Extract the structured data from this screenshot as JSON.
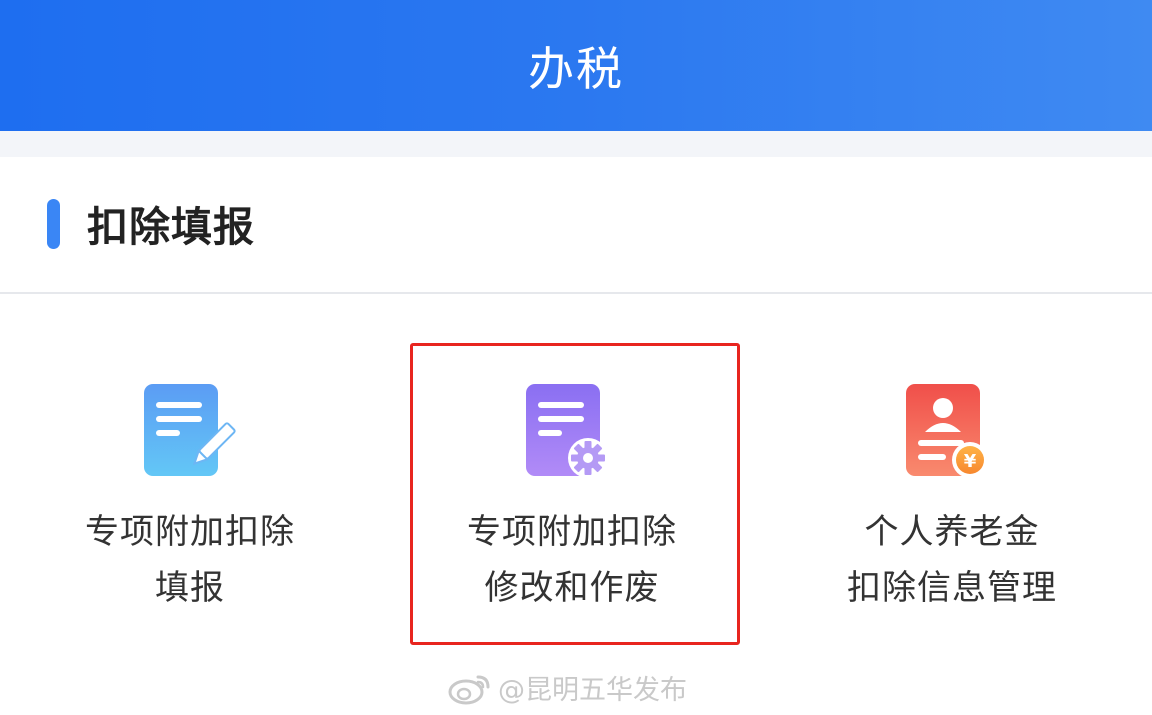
{
  "header": {
    "title": "办税"
  },
  "section": {
    "title": "扣除填报"
  },
  "tiles": [
    {
      "line1": "专项附加扣除",
      "line2": "填报",
      "icon": "document-pencil-icon",
      "icon_color": "#4aa0f2"
    },
    {
      "line1": "专项附加扣除",
      "line2": "修改和作废",
      "icon": "document-gear-icon",
      "icon_color": "#9b7cf5"
    },
    {
      "line1": "个人养老金",
      "line2": "扣除信息管理",
      "icon": "document-person-yen-icon",
      "icon_color": "#f45a52"
    }
  ],
  "watermark": {
    "text": "@昆明五华发布",
    "icon": "weibo-logo-icon"
  },
  "colors": {
    "header_gradient_start": "#1e6ef0",
    "header_gradient_end": "#3f8af2",
    "section_accent": "#3a86f5",
    "highlight_border": "#e8251f"
  }
}
